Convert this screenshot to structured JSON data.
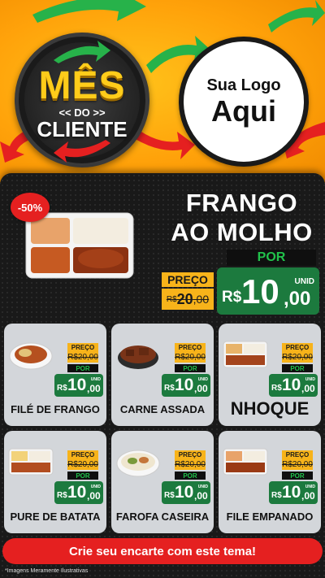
{
  "colors": {
    "accent_red": "#e52020",
    "orange": "#ffa20a",
    "price_green": "#1c7a3e",
    "label_yellow": "#f7b31a",
    "panel_dark": "#191919",
    "card_gray": "#d3d6da"
  },
  "badge": {
    "line1": "MÊS",
    "line2": "<< DO >>",
    "line3": "CLIENTE"
  },
  "logo": {
    "line1": "Sua Logo",
    "line2": "Aqui"
  },
  "featured": {
    "discount": "-50%",
    "title_line1": "FRANGO",
    "title_line2": "AO MOLHO",
    "preco_label": "PREÇO",
    "old_currency": "R$",
    "old_int": "20",
    "old_dec": ",00",
    "por_label": "POR",
    "unid": "UNID",
    "currency": "R$",
    "price_int": "10",
    "price_dec": ",00",
    "image_icon": "food-tray"
  },
  "products": [
    {
      "name": "FILÉ DE FRANGO",
      "preco_label": "PREÇO",
      "old": "R$20,00",
      "por_label": "POR",
      "currency": "R$",
      "int": "10",
      "dec": ",00",
      "unid": "UNID",
      "icon": "bowl-chicken"
    },
    {
      "name": "CARNE ASSADA",
      "preco_label": "PREÇO",
      "old": "R$20,00",
      "por_label": "POR",
      "currency": "R$",
      "int": "10",
      "dec": ",00",
      "unid": "UNID",
      "icon": "bowl-meat"
    },
    {
      "name": "NHOQUE",
      "preco_label": "PREÇO",
      "old": "R$20,00",
      "por_label": "POR",
      "currency": "R$",
      "int": "10",
      "dec": ",00",
      "unid": "UNID",
      "icon": "tray-meal"
    },
    {
      "name": "PURE DE BATATA",
      "preco_label": "PREÇO",
      "old": "R$20,00",
      "por_label": "POR",
      "currency": "R$",
      "int": "10",
      "dec": ",00",
      "unid": "UNID",
      "icon": "tray-meal"
    },
    {
      "name": "FAROFA CASEIRA",
      "preco_label": "PREÇO",
      "old": "R$20,00",
      "por_label": "POR",
      "currency": "R$",
      "int": "10",
      "dec": ",00",
      "unid": "UNID",
      "icon": "bowl-rice"
    },
    {
      "name": "FILE EMPANADO",
      "preco_label": "PREÇO",
      "old": "R$20,00",
      "por_label": "POR",
      "currency": "R$",
      "int": "10",
      "dec": ",00",
      "unid": "UNID",
      "icon": "tray-meal"
    }
  ],
  "cta": {
    "label": "Crie seu encarte com este tema!"
  },
  "footer": {
    "note": "*Imagens Meramente Ilustrativas"
  }
}
